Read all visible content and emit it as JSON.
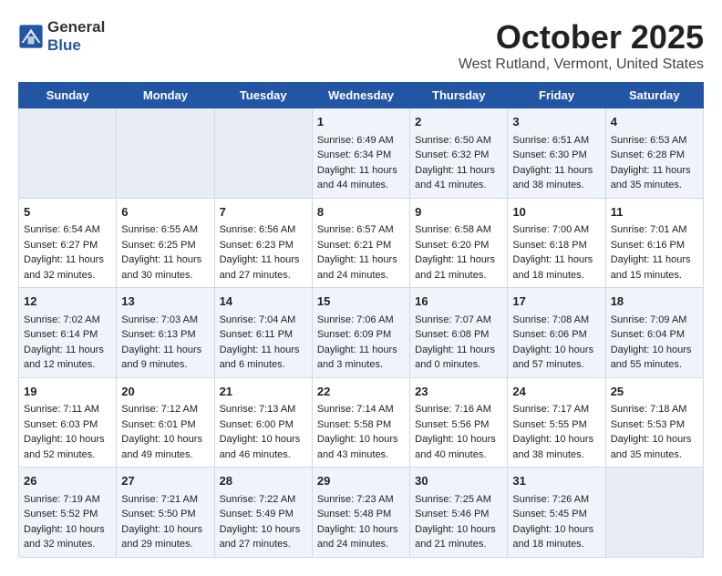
{
  "header": {
    "logo_general": "General",
    "logo_blue": "Blue",
    "month": "October 2025",
    "location": "West Rutland, Vermont, United States"
  },
  "days_of_week": [
    "Sunday",
    "Monday",
    "Tuesday",
    "Wednesday",
    "Thursday",
    "Friday",
    "Saturday"
  ],
  "weeks": [
    [
      {
        "day": "",
        "content": ""
      },
      {
        "day": "",
        "content": ""
      },
      {
        "day": "",
        "content": ""
      },
      {
        "day": "1",
        "content": "Sunrise: 6:49 AM\nSunset: 6:34 PM\nDaylight: 11 hours and 44 minutes."
      },
      {
        "day": "2",
        "content": "Sunrise: 6:50 AM\nSunset: 6:32 PM\nDaylight: 11 hours and 41 minutes."
      },
      {
        "day": "3",
        "content": "Sunrise: 6:51 AM\nSunset: 6:30 PM\nDaylight: 11 hours and 38 minutes."
      },
      {
        "day": "4",
        "content": "Sunrise: 6:53 AM\nSunset: 6:28 PM\nDaylight: 11 hours and 35 minutes."
      }
    ],
    [
      {
        "day": "5",
        "content": "Sunrise: 6:54 AM\nSunset: 6:27 PM\nDaylight: 11 hours and 32 minutes."
      },
      {
        "day": "6",
        "content": "Sunrise: 6:55 AM\nSunset: 6:25 PM\nDaylight: 11 hours and 30 minutes."
      },
      {
        "day": "7",
        "content": "Sunrise: 6:56 AM\nSunset: 6:23 PM\nDaylight: 11 hours and 27 minutes."
      },
      {
        "day": "8",
        "content": "Sunrise: 6:57 AM\nSunset: 6:21 PM\nDaylight: 11 hours and 24 minutes."
      },
      {
        "day": "9",
        "content": "Sunrise: 6:58 AM\nSunset: 6:20 PM\nDaylight: 11 hours and 21 minutes."
      },
      {
        "day": "10",
        "content": "Sunrise: 7:00 AM\nSunset: 6:18 PM\nDaylight: 11 hours and 18 minutes."
      },
      {
        "day": "11",
        "content": "Sunrise: 7:01 AM\nSunset: 6:16 PM\nDaylight: 11 hours and 15 minutes."
      }
    ],
    [
      {
        "day": "12",
        "content": "Sunrise: 7:02 AM\nSunset: 6:14 PM\nDaylight: 11 hours and 12 minutes."
      },
      {
        "day": "13",
        "content": "Sunrise: 7:03 AM\nSunset: 6:13 PM\nDaylight: 11 hours and 9 minutes."
      },
      {
        "day": "14",
        "content": "Sunrise: 7:04 AM\nSunset: 6:11 PM\nDaylight: 11 hours and 6 minutes."
      },
      {
        "day": "15",
        "content": "Sunrise: 7:06 AM\nSunset: 6:09 PM\nDaylight: 11 hours and 3 minutes."
      },
      {
        "day": "16",
        "content": "Sunrise: 7:07 AM\nSunset: 6:08 PM\nDaylight: 11 hours and 0 minutes."
      },
      {
        "day": "17",
        "content": "Sunrise: 7:08 AM\nSunset: 6:06 PM\nDaylight: 10 hours and 57 minutes."
      },
      {
        "day": "18",
        "content": "Sunrise: 7:09 AM\nSunset: 6:04 PM\nDaylight: 10 hours and 55 minutes."
      }
    ],
    [
      {
        "day": "19",
        "content": "Sunrise: 7:11 AM\nSunset: 6:03 PM\nDaylight: 10 hours and 52 minutes."
      },
      {
        "day": "20",
        "content": "Sunrise: 7:12 AM\nSunset: 6:01 PM\nDaylight: 10 hours and 49 minutes."
      },
      {
        "day": "21",
        "content": "Sunrise: 7:13 AM\nSunset: 6:00 PM\nDaylight: 10 hours and 46 minutes."
      },
      {
        "day": "22",
        "content": "Sunrise: 7:14 AM\nSunset: 5:58 PM\nDaylight: 10 hours and 43 minutes."
      },
      {
        "day": "23",
        "content": "Sunrise: 7:16 AM\nSunset: 5:56 PM\nDaylight: 10 hours and 40 minutes."
      },
      {
        "day": "24",
        "content": "Sunrise: 7:17 AM\nSunset: 5:55 PM\nDaylight: 10 hours and 38 minutes."
      },
      {
        "day": "25",
        "content": "Sunrise: 7:18 AM\nSunset: 5:53 PM\nDaylight: 10 hours and 35 minutes."
      }
    ],
    [
      {
        "day": "26",
        "content": "Sunrise: 7:19 AM\nSunset: 5:52 PM\nDaylight: 10 hours and 32 minutes."
      },
      {
        "day": "27",
        "content": "Sunrise: 7:21 AM\nSunset: 5:50 PM\nDaylight: 10 hours and 29 minutes."
      },
      {
        "day": "28",
        "content": "Sunrise: 7:22 AM\nSunset: 5:49 PM\nDaylight: 10 hours and 27 minutes."
      },
      {
        "day": "29",
        "content": "Sunrise: 7:23 AM\nSunset: 5:48 PM\nDaylight: 10 hours and 24 minutes."
      },
      {
        "day": "30",
        "content": "Sunrise: 7:25 AM\nSunset: 5:46 PM\nDaylight: 10 hours and 21 minutes."
      },
      {
        "day": "31",
        "content": "Sunrise: 7:26 AM\nSunset: 5:45 PM\nDaylight: 10 hours and 18 minutes."
      },
      {
        "day": "",
        "content": ""
      }
    ]
  ]
}
